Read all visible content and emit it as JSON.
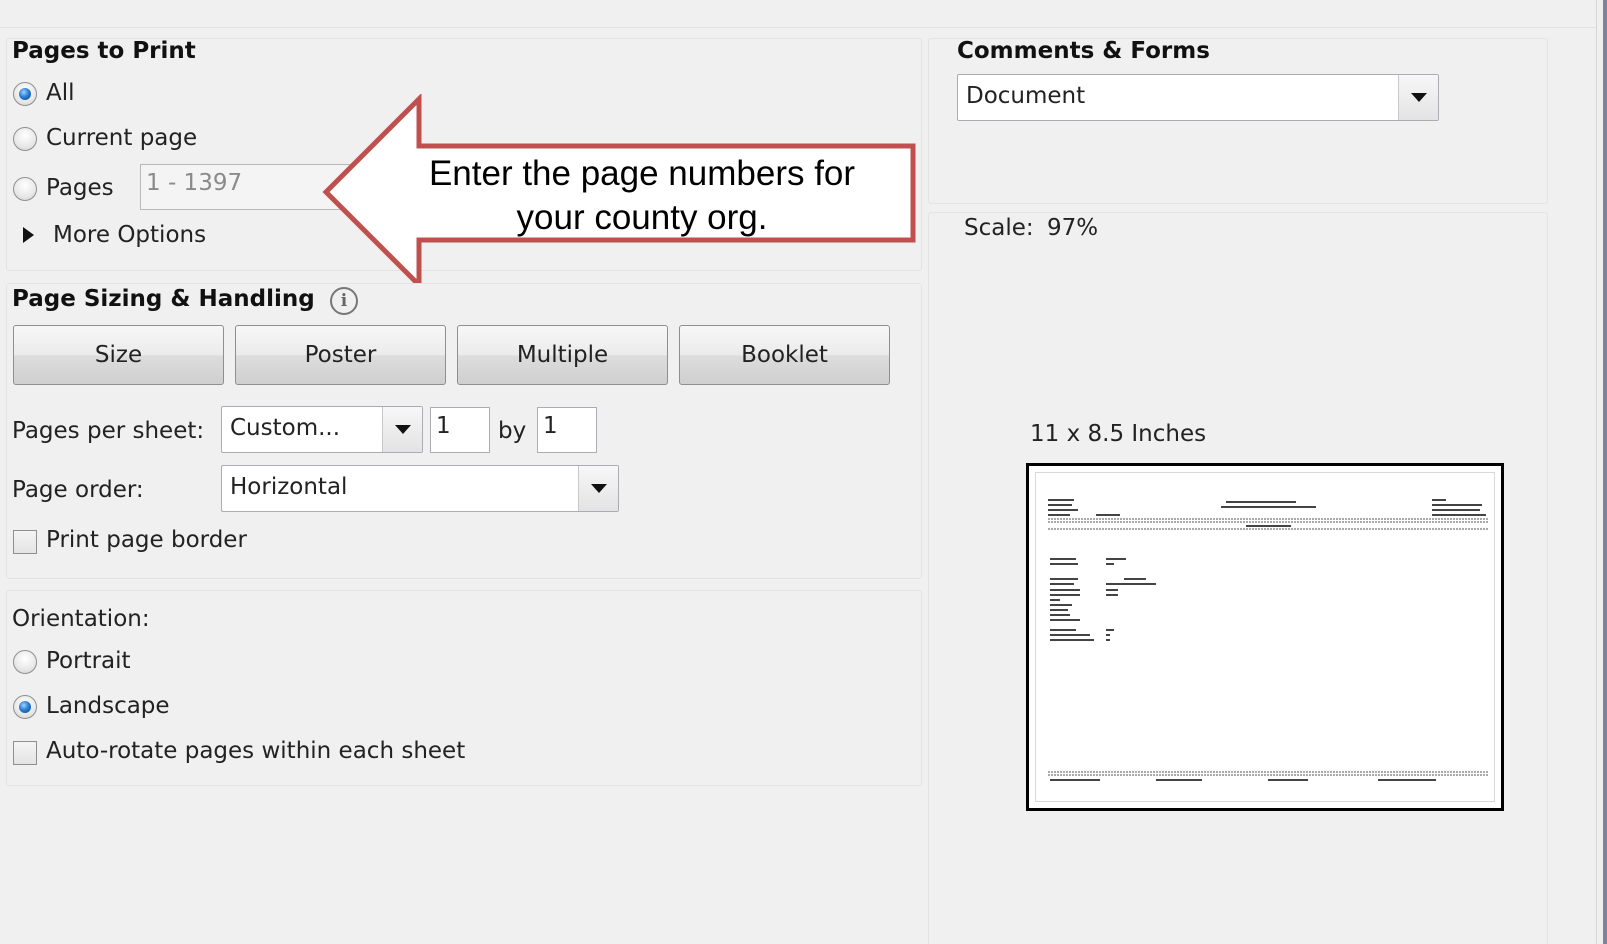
{
  "pages_to_print": {
    "title": "Pages to Print",
    "all_label": "All",
    "current_label": "Current page",
    "pages_label": "Pages",
    "pages_value": "1 - 1397",
    "more_options_label": "More Options",
    "selected": "All"
  },
  "callout": {
    "text": "Enter the page numbers for your county org.",
    "border_color": "#c0504d"
  },
  "comments_forms": {
    "title": "Comments & Forms",
    "selected_value": "Document"
  },
  "scale": {
    "label": "Scale:",
    "value": "97%"
  },
  "page_sizing": {
    "title": "Page Sizing & Handling",
    "buttons": [
      "Size",
      "Poster",
      "Multiple",
      "Booklet"
    ],
    "pages_per_sheet_label": "Pages per sheet:",
    "pages_per_sheet_value": "Custom...",
    "rows_value": "1",
    "by_label": "by",
    "cols_value": "1",
    "page_order_label": "Page order:",
    "page_order_value": "Horizontal",
    "print_border_label": "Print page border",
    "print_border_checked": false
  },
  "orientation": {
    "title": "Orientation:",
    "portrait_label": "Portrait",
    "landscape_label": "Landscape",
    "selected": "Landscape",
    "autorotate_label": "Auto-rotate pages within each sheet",
    "autorotate_checked": false
  },
  "preview": {
    "size_label": "11 x 8.5 Inches"
  },
  "colors": {
    "radio_selected": "#2a7fd6",
    "accent_border": "#c0504d"
  }
}
